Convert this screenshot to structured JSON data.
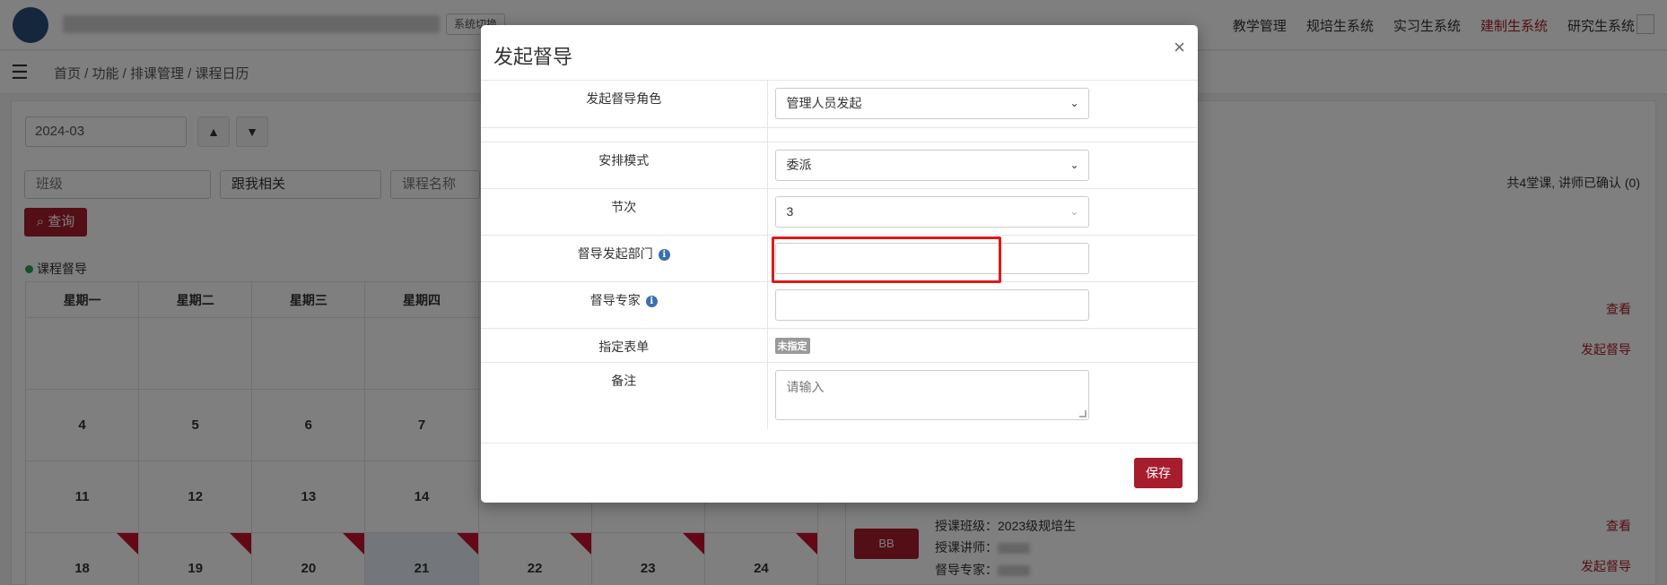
{
  "topbar": {
    "system_switch": "系统切换",
    "nav": [
      {
        "label": "教学管理",
        "active": false
      },
      {
        "label": "规培生系统",
        "active": false
      },
      {
        "label": "实习生系统",
        "active": false
      },
      {
        "label": "建制生系统",
        "active": true
      },
      {
        "label": "研究生系统",
        "active": false
      }
    ]
  },
  "breadcrumb": "首页 / 功能 / 排课管理 / 课程日历",
  "toolbar": {
    "month": "2024-03",
    "filters": {
      "class_placeholder": "班级",
      "relation_value": "跟我相关",
      "course_placeholder": "课程名称"
    },
    "query_label": "查询",
    "legend_label": "课程督导",
    "summary": "共4堂课, 讲师已确认 (0)"
  },
  "calendar": {
    "weekdays": [
      "星期一",
      "星期二",
      "星期三",
      "星期四"
    ],
    "row2": [
      "4",
      "5",
      "6",
      "7"
    ],
    "row3": [
      "11",
      "12",
      "13",
      "14"
    ],
    "row4": [
      "18",
      "19",
      "20",
      "21",
      "22",
      "23",
      "24"
    ]
  },
  "side_panel": {
    "view_label": "查看",
    "start_label": "发起督导",
    "bb_label": "BB",
    "class_line": "授课班级：2023级规培生",
    "teacher_line": "授课讲师：",
    "expert_line": "督导专家："
  },
  "modal": {
    "title": "发起督导",
    "close": "×",
    "fields": {
      "role_label": "发起督导角色",
      "role_value": "管理人员发起",
      "mode_label": "安排模式",
      "mode_value": "委派",
      "period_label": "节次",
      "period_value": "3",
      "dept_label": "督导发起部门",
      "dept_value": "",
      "expert_label": "督导专家",
      "expert_value": "",
      "form_label": "指定表单",
      "form_tag": "未指定",
      "remark_label": "备注",
      "remark_placeholder": "请输入"
    },
    "save_label": "保存"
  },
  "colors": {
    "brand": "#a61d2d",
    "highlight": "#e01818",
    "info": "#3a6fb0"
  }
}
